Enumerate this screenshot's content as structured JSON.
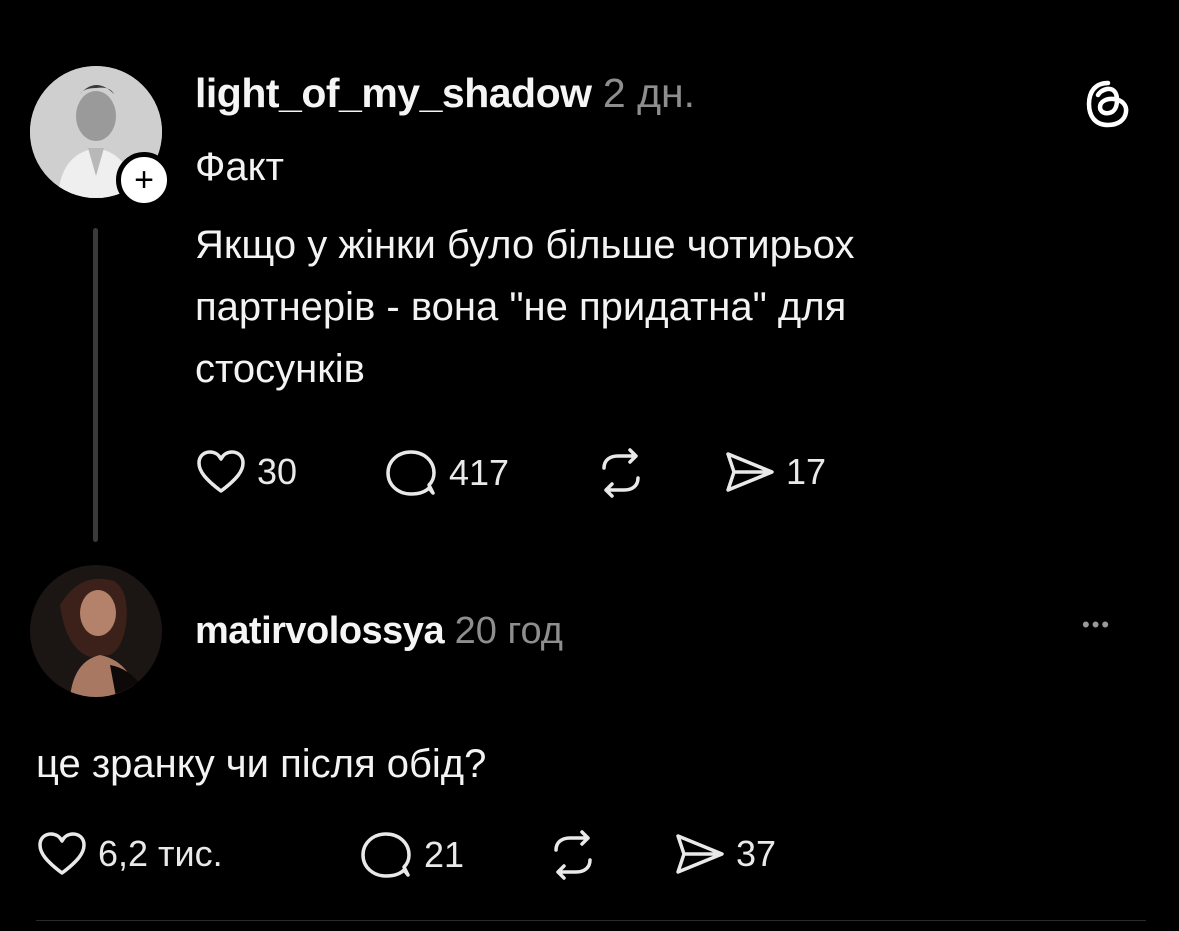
{
  "post": {
    "username": "light_of_my_shadow",
    "time": "2 дн.",
    "tag": "Факт",
    "text_lines": [
      "Якщо у жінки було більше чотирьох",
      "партнерів - вона \"не придатна\" для",
      "стосунків"
    ],
    "likes": "30",
    "comments": "417",
    "shares": "17",
    "follow_symbol": "+"
  },
  "reply": {
    "username": "matirvolossya",
    "time": "20 год",
    "text": "це зранку чи після обід?",
    "likes": "6,2 тис.",
    "comments": "21",
    "shares": "37",
    "more_symbol": "•••"
  },
  "icons": {
    "threads_logo": "threads-logo-icon",
    "like": "heart-icon",
    "comment": "comment-icon",
    "repost": "repost-icon",
    "share": "share-icon"
  }
}
